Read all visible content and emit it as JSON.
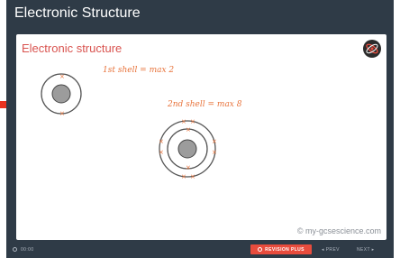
{
  "window": {
    "title": "Electronic Structure"
  },
  "slide": {
    "title": "Electronic structure",
    "annotation_1": "1st shell = max 2",
    "annotation_2": "2nd shell = max 8",
    "copyright": "© my-gcsescience.com"
  },
  "controls": {
    "timer": "00:00",
    "revision_plus": "REVISION PLUS",
    "prev": "◂ PREV",
    "next": "NEXT ▸"
  },
  "colors": {
    "app_background": "#2f3b47",
    "accent_red": "#e84c3d",
    "annotation_orange": "#e8733b",
    "title_red": "#d9534f"
  },
  "icons": {
    "pointer": "arrow-right-icon",
    "logo": "atom-logo-icon",
    "timer": "clock-icon"
  }
}
